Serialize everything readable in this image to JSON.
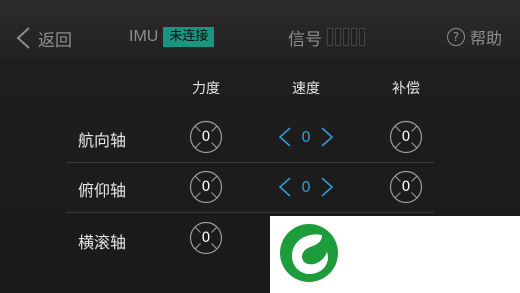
{
  "header": {
    "back_label": "返回",
    "imu_label": "IMU",
    "imu_status": "未连接",
    "signal_label": "信号",
    "signal_bars": 5,
    "help_label": "帮助"
  },
  "columns": {
    "force": "力度",
    "speed": "速度",
    "compensation": "补偿"
  },
  "rows": [
    {
      "label": "航向轴",
      "force": "0",
      "speed": "0",
      "compensation": "0"
    },
    {
      "label": "俯仰轴",
      "force": "0",
      "speed": "0",
      "compensation": "0"
    },
    {
      "label": "横滚轴",
      "force": "0"
    }
  ],
  "colors": {
    "accent_teal": "#179680",
    "speed_blue": "#2f9bd6",
    "logo_green": "#1e9b3b"
  },
  "icons": {
    "back": "chevron-left-icon",
    "help": "question-circle-icon",
    "knob": "dial-knob-icon",
    "speed_left": "chevron-left-icon",
    "speed_right": "chevron-right-icon",
    "logo": "leaf-logo-icon"
  }
}
